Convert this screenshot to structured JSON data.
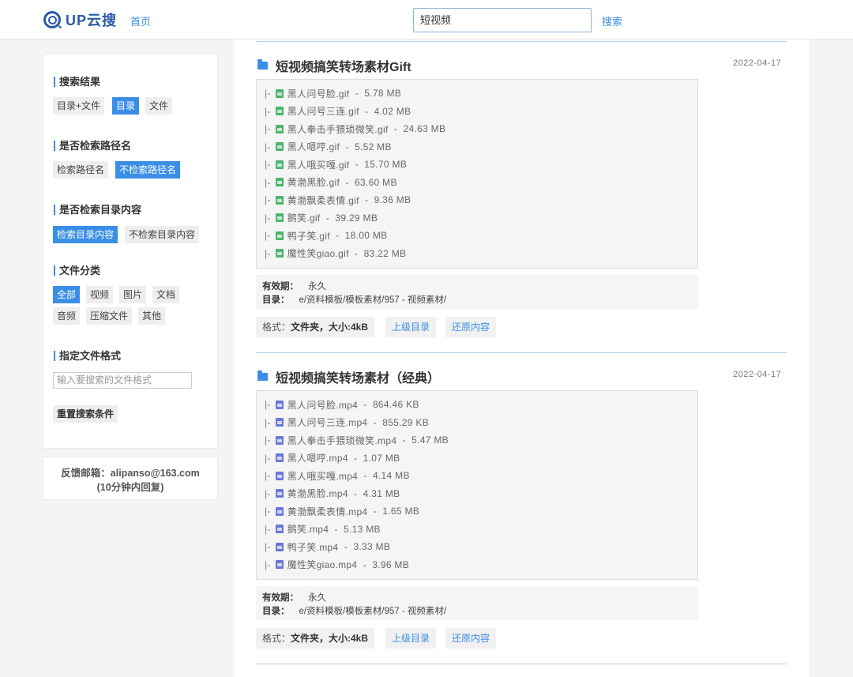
{
  "header": {
    "logo": "UP云搜",
    "home_label": "首页",
    "search_value": "短视频",
    "search_button": "搜索"
  },
  "sidebar": {
    "result_title": "搜索结果",
    "result_opts": [
      "目录+文件",
      "目录",
      "文件"
    ],
    "path_title": "是否检索路径名",
    "path_opts": [
      "检索路径名",
      "不检索路径名"
    ],
    "content_title": "是否检索目录内容",
    "content_opts": [
      "检索目录内容",
      "不检索目录内容"
    ],
    "category_title": "文件分类",
    "category_opts": [
      "全部",
      "视频",
      "图片",
      "文档",
      "音频",
      "压缩文件",
      "其他"
    ],
    "format_title": "指定文件格式",
    "format_placeholder": "输入要搜索的文件格式",
    "reset_label": "重置搜索条件"
  },
  "feedback": {
    "line1": "反馈邮箱：alipanso@163.com",
    "line2": "(10分钟内回复)"
  },
  "results": [
    {
      "title": "短视频搞笑转场素材Gift",
      "date": "2022-04-17",
      "files": [
        {
          "name": "黑人问号脸.gif",
          "size": "5.78 MB"
        },
        {
          "name": "黑人问号三连.gif",
          "size": "4.02 MB"
        },
        {
          "name": "黑人拳击手猥琐微笑.gif",
          "size": "24.63 MB"
        },
        {
          "name": "黑人嗯哼.gif",
          "size": "5.52 MB"
        },
        {
          "name": "黑人哦买嘎.gif",
          "size": "15.70 MB"
        },
        {
          "name": "黄渤黑脸.gif",
          "size": "63.60 MB"
        },
        {
          "name": "黄渤飘柔表情.gif",
          "size": "9.36 MB"
        },
        {
          "name": "鹅笑.gif",
          "size": "39.29 MB"
        },
        {
          "name": "鸭子笑.gif",
          "size": "18.00 MB"
        },
        {
          "name": "魔性笑giao.gif",
          "size": "83.22 MB"
        }
      ],
      "validity_label": "有效期：",
      "validity": "永久",
      "dir_label": "目录：",
      "dir": "e/资料模板/模板素材/957 - 视频素材/",
      "format_prefix": "格式：",
      "format_value": "文件夹，大小:4kB",
      "parent_btn": "上级目录",
      "restore_btn": "还原内容"
    },
    {
      "title": "短视频搞笑转场素材（经典）",
      "date": "2022-04-17",
      "files": [
        {
          "name": "黑人问号脸.mp4",
          "size": "864.46 KB"
        },
        {
          "name": "黑人问号三连.mp4",
          "size": "855.29 KB"
        },
        {
          "name": "黑人拳击手猥琐微笑.mp4",
          "size": "5.47 MB"
        },
        {
          "name": "黑人嗯哼.mp4",
          "size": "1.07 MB"
        },
        {
          "name": "黑人哦买嘎.mp4",
          "size": "4.14 MB"
        },
        {
          "name": "黄渤黑脸.mp4",
          "size": "4.31 MB"
        },
        {
          "name": "黄渤飘柔表情.mp4",
          "size": "1.65 MB"
        },
        {
          "name": "鹅笑.mp4",
          "size": "5.13 MB"
        },
        {
          "name": "鸭子笑.mp4",
          "size": "3.33 MB"
        },
        {
          "name": "魔性笑giao.mp4",
          "size": "3.96 MB"
        }
      ],
      "validity_label": "有效期：",
      "validity": "永久",
      "dir_label": "目录：",
      "dir": "e/资料模板/模板素材/957 - 视频素材/",
      "format_prefix": "格式：",
      "format_value": "文件夹，大小:4kB",
      "parent_btn": "上级目录",
      "restore_btn": "还原内容"
    }
  ]
}
